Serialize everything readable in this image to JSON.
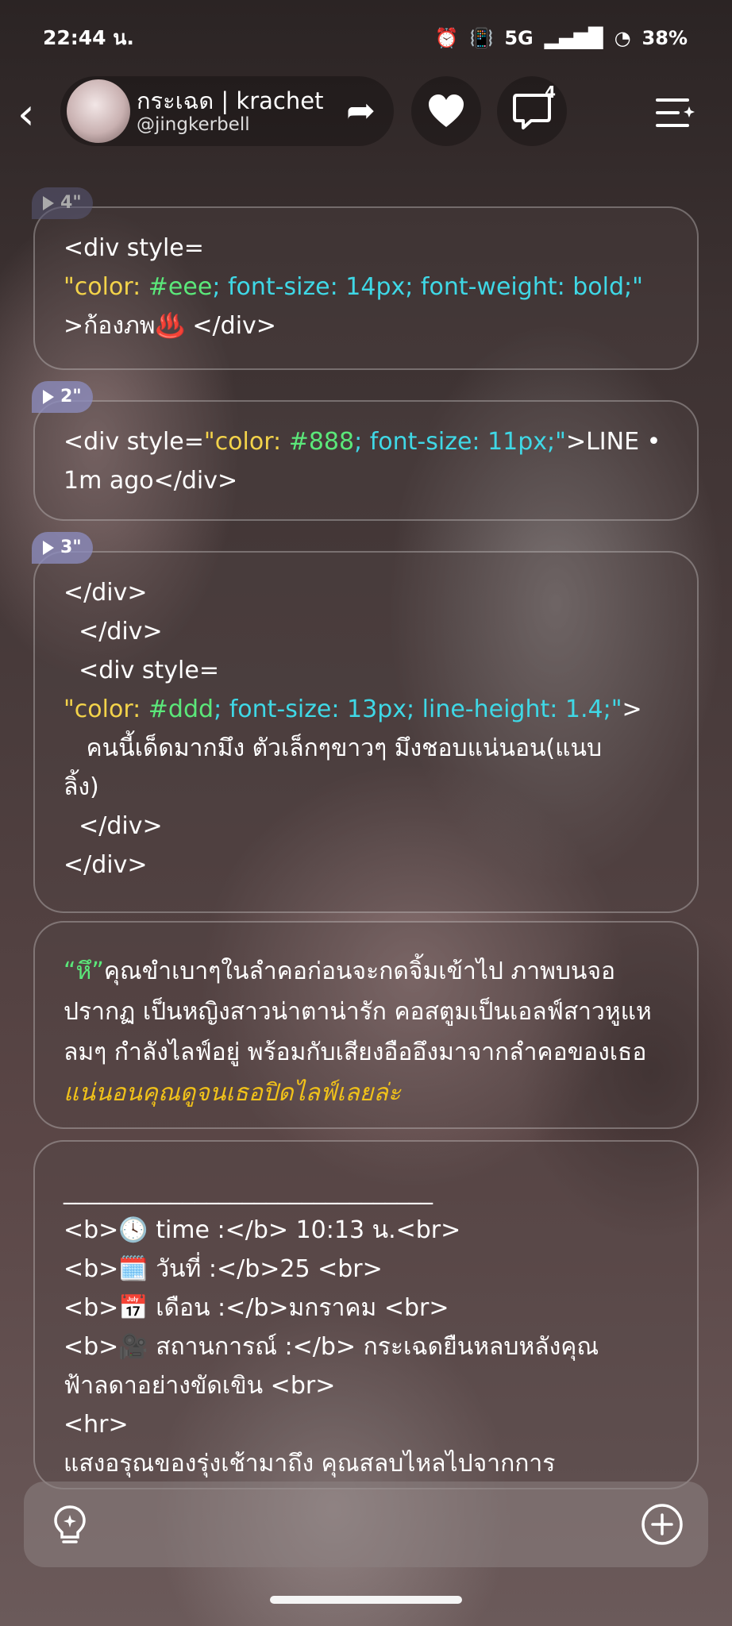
{
  "status": {
    "time": "22:44 น.",
    "battery": "38%",
    "network": "5G"
  },
  "header": {
    "name": "กระเฉด | krachet",
    "handle": "@jingkerbell",
    "comment_count": "4"
  },
  "cards": [
    {
      "duration": "4\"",
      "lines": [
        "<div style=",
        "\"color: #eee; font-size: 14px; font-weight: bold;\"",
        ">ก้องภพ♨️ </div>"
      ]
    },
    {
      "duration": "2\"",
      "lines": [
        "<div style=\"color: #888; font-size: 11px;\">LINE •",
        "1m ago</div>"
      ]
    },
    {
      "duration": "3\"",
      "lines": [
        "</div>",
        "  </div>",
        "  <div style=",
        "\"color: #ddd; font-size: 13px; line-height: 1.4;\">",
        "   คนนี้เด็ดมากมึง ตัวเล็กๆขาวๆ มึงชอบแน่นอน(แนบ",
        "ลิ้ง)",
        "  </div>",
        "</div>"
      ]
    },
    {
      "quote": "“หึ”",
      "body": "คุณขำเบาๆในลำคอก่อนจะกดจิ้มเข้าไป ภาพบนจอปรากฏ เป็นหญิงสาวน่าตาน่ารัก คอสตูมเป็นเอลฟ์สาวหูแหลมๆ กำลังไลฟ์อยู่ พร้อมกับเสียงอืออึงมาจากลำคอของเธอ ",
      "emph": "แน่นอนคุณดูจนเธอปิดไลฟ์เลยล่ะ"
    },
    {
      "lines": [
        "_______________________________",
        "<b>🕓 time :</b> 10:13 น.<br>",
        "<b>🗓️ วันที่ :</b>25 <br>",
        "<b>📅 เดือน :</b>มกราคม <br>",
        "<b>🎥 สถานการณ์ :</b> กระเฉดยืนหลบหลังคุณ",
        "ฟ้าลดาอย่างขัดเขิน <br>",
        "<hr>",
        "แสงอรุณของรุ่งเช้ามาถึง คุณสลบไหลไปจากการ"
      ]
    }
  ]
}
